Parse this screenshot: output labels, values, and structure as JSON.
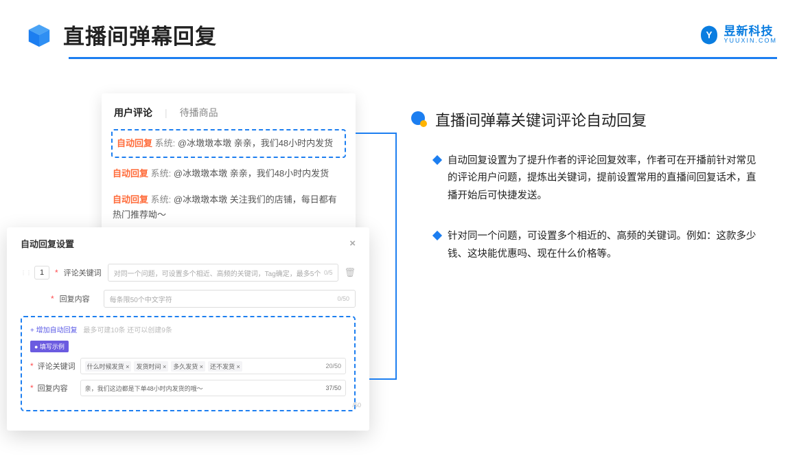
{
  "header": {
    "title": "直播间弹幕回复",
    "brand_cn": "昱新科技",
    "brand_en": "YUUXIN.COM"
  },
  "comments": {
    "tab_active": "用户评论",
    "tab_inactive": "待播商品",
    "rows": [
      {
        "tag": "自动回复",
        "sys": "系统:",
        "text": "@冰墩墩本墩 亲亲，我们48小时内发货",
        "highlight": true
      },
      {
        "tag": "自动回复",
        "sys": "系统:",
        "text": "@冰墩墩本墩 亲亲，我们48小时内发货",
        "highlight": false
      },
      {
        "tag": "自动回复",
        "sys": "系统:",
        "text": "@冰墩墩本墩 关注我们的店铺，每日都有热门推荐呦～",
        "highlight": false
      }
    ]
  },
  "modal": {
    "title": "自动回复设置",
    "close": "×",
    "index": "1",
    "field_keyword_label": "评论关键词",
    "field_keyword_ph": "对同一个问题，可设置多个相近、高频的关键词，Tag确定，最多5个",
    "field_keyword_cnt": "0/5",
    "field_reply_label": "回复内容",
    "field_reply_ph": "每条限50个中文字符",
    "field_reply_cnt": "0/50",
    "add_rule": "+ 增加自动回复",
    "add_rule_hint": "最多可建10条 还可以创建9条",
    "example_badge": "● 填写示例",
    "ex_kw_label": "评论关键词",
    "ex_tags": [
      "什么时候发货 ×",
      "发货时间 ×",
      "多久发货 ×",
      "还不发货 ×"
    ],
    "ex_kw_cnt": "20/50",
    "ex_reply_label": "回复内容",
    "ex_reply_val": "亲，我们这边都是下单48小时内发货的哦～",
    "ex_reply_cnt": "37/50",
    "float_cnt": "/50"
  },
  "right": {
    "title": "直播间弹幕关键词评论自动回复",
    "bullets": [
      "自动回复设置为了提升作者的评论回复效率，作者可在开播前针对常见的评论用户问题，提炼出关键词，提前设置常用的直播间回复话术，直播开始后可快捷发送。",
      "针对同一个问题，可设置多个相近的、高频的关键词。例如：这款多少钱、这块能优惠吗、现在什么价格等。"
    ]
  }
}
